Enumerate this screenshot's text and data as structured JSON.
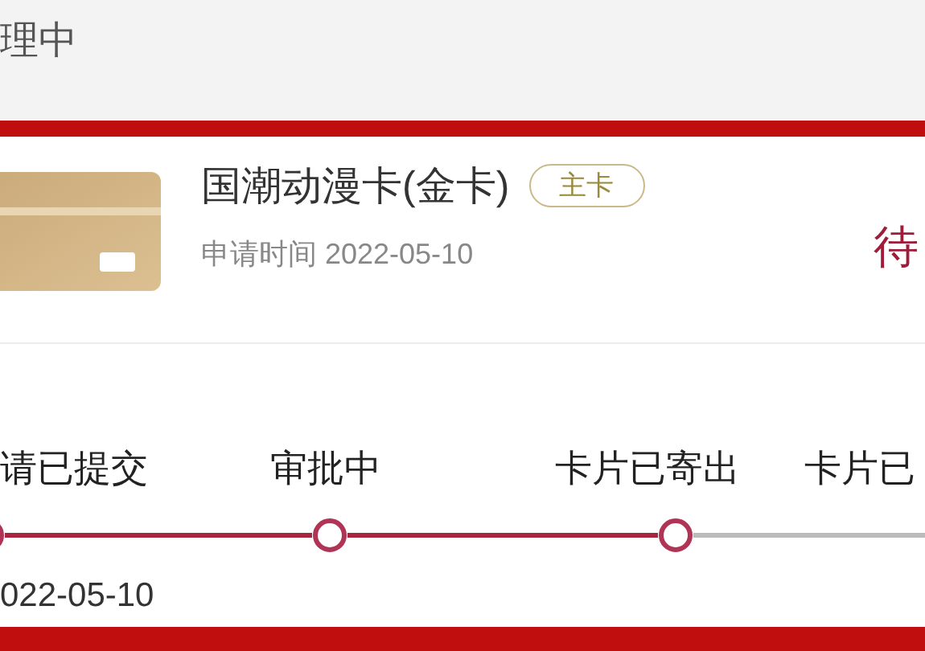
{
  "header": {
    "status": "理中"
  },
  "card": {
    "name": "国潮动漫卡(金卡)",
    "badge": "主卡",
    "apply_date": "申请时间 2022-05-10",
    "status": "待"
  },
  "steps": [
    {
      "label": "请已提交",
      "date": "022-05-10",
      "reached": true
    },
    {
      "label": "审批中",
      "reached": true
    },
    {
      "label": "卡片已寄出",
      "reached": true
    },
    {
      "label": "卡片已",
      "reached": false
    }
  ]
}
